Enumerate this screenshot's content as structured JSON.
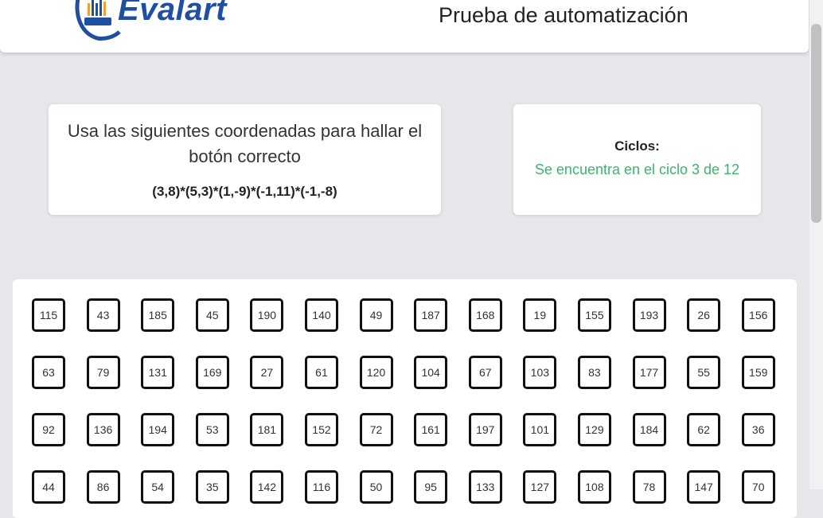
{
  "header": {
    "logo_text": "Evalart",
    "title": "Prueba de automatización"
  },
  "instructions": {
    "text": "Usa las siguientes coordenadas para hallar el botón correcto",
    "coordinates": "(3,8)*(5,3)*(1,-9)*(-1,11)*(-1,-8)"
  },
  "cycles": {
    "label": "Ciclos:",
    "status": "Se encuentra en el ciclo 3 de 12"
  },
  "colors": {
    "brand": "#1e4fa0",
    "status": "#3cb46e"
  },
  "grid": {
    "rows": [
      [
        "115",
        "43",
        "185",
        "45",
        "190",
        "140",
        "49",
        "187",
        "168",
        "19",
        "155",
        "193",
        "26",
        "156"
      ],
      [
        "63",
        "79",
        "131",
        "169",
        "27",
        "61",
        "120",
        "104",
        "67",
        "103",
        "83",
        "177",
        "55",
        "159"
      ],
      [
        "92",
        "136",
        "194",
        "53",
        "181",
        "152",
        "72",
        "161",
        "197",
        "101",
        "129",
        "184",
        "62",
        "36"
      ],
      [
        "44",
        "86",
        "54",
        "35",
        "142",
        "116",
        "50",
        "95",
        "133",
        "127",
        "108",
        "78",
        "147",
        "70"
      ]
    ]
  }
}
